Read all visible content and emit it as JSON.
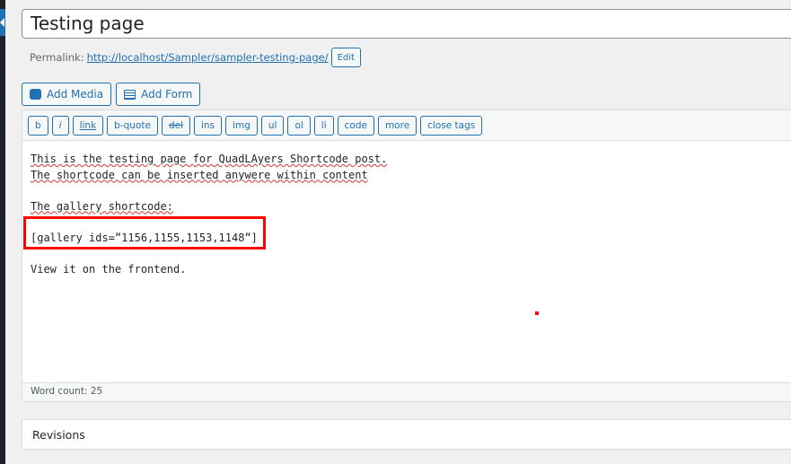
{
  "title": "Testing page",
  "permalink": {
    "label": "Permalink:",
    "url": "http://localhost/Sampler/sampler-testing-page/",
    "edit": "Edit"
  },
  "media": {
    "add_media": "Add Media",
    "add_form": "Add Form"
  },
  "toolbar": [
    "b",
    "i",
    "link",
    "b-quote",
    "del",
    "ins",
    "img",
    "ul",
    "ol",
    "li",
    "code",
    "more",
    "close tags"
  ],
  "content": [
    "This is the testing page for QuadLAyers Shortcode post.",
    "The shortcode can be inserted anywere within content",
    "",
    "The gallery shortcode:",
    "",
    "[gallery ids=”1156,1155,1153,1148”]",
    "",
    "View it on the frontend."
  ],
  "word_count": "Word count: 25",
  "revisions": "Revisions"
}
